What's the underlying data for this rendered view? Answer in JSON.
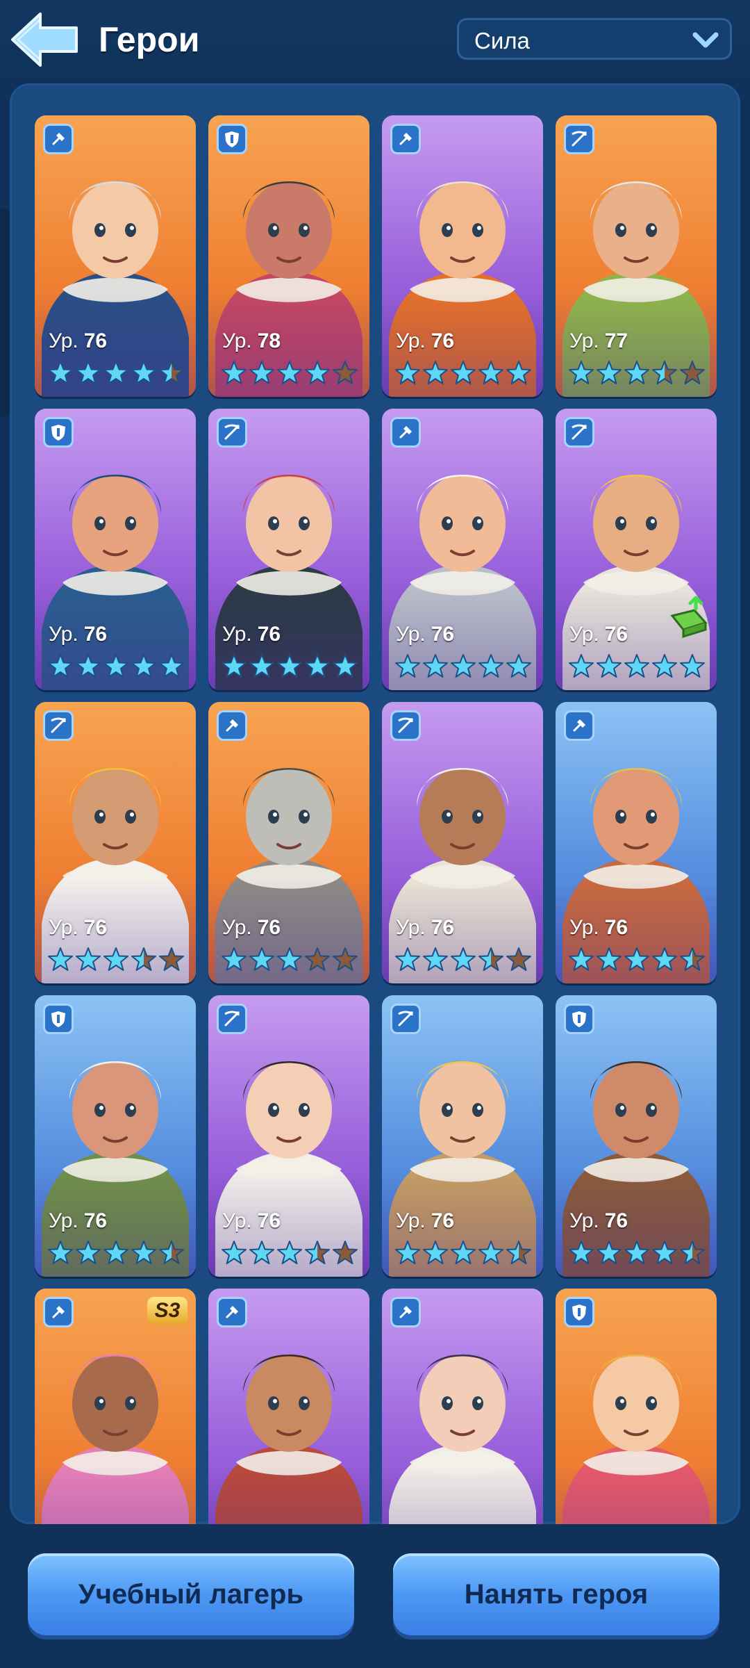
{
  "header": {
    "title": "Герои",
    "sort": {
      "selected": "Сила"
    }
  },
  "level_prefix": "Ур.",
  "heroes": [
    {
      "level": "76",
      "stars": 4.5,
      "class": "shovel",
      "bg": "orange",
      "hair": "#d7dbe6",
      "skin": "#f3c9a8",
      "coat": "#2a4f86"
    },
    {
      "level": "78",
      "stars": 4,
      "class": "shield",
      "bg": "orange",
      "hair": "#3b3b3b",
      "skin": "#c97a68",
      "coat": "#c44764"
    },
    {
      "level": "76",
      "stars": 5,
      "class": "shovel",
      "bg": "purple",
      "hair": "#f0e0c8",
      "skin": "#f1b98d",
      "coat": "#e5702a"
    },
    {
      "level": "77",
      "stars": 3.5,
      "class": "crossbow",
      "bg": "orange",
      "hair": "#e6e6e6",
      "skin": "#e9b089",
      "coat": "#8fb54a"
    },
    {
      "level": "76",
      "stars": 5,
      "class": "shield",
      "bg": "purple",
      "hair": "#1f4a78",
      "skin": "#e7a37e",
      "coat": "#2a5d8f"
    },
    {
      "level": "76",
      "stars": 5,
      "class": "crossbow",
      "bg": "purple",
      "hair": "#d23b3f",
      "skin": "#f2c3a4",
      "coat": "#2b3b47"
    },
    {
      "level": "76",
      "stars": 5,
      "class": "shovel",
      "bg": "purple",
      "hair": "#f6f2ec",
      "skin": "#f1bb98",
      "coat": "#b9bec8"
    },
    {
      "level": "76",
      "stars": 5,
      "class": "crossbow",
      "bg": "purple",
      "hair": "#f1c542",
      "skin": "#e7ad83",
      "coat": "#e8e4dc",
      "upgrade": true
    },
    {
      "level": "76",
      "stars": 3.5,
      "class": "crossbow",
      "bg": "orange",
      "hair": "#f0c33a",
      "skin": "#d59b73",
      "coat": "#f2f0ec"
    },
    {
      "level": "76",
      "stars": 3,
      "class": "shovel",
      "bg": "orange",
      "hair": "#4a4a4a",
      "skin": "#bfbdb7",
      "coat": "#8d8a86"
    },
    {
      "level": "76",
      "stars": 3.5,
      "class": "crossbow",
      "bg": "purple",
      "hair": "#f2efe8",
      "skin": "#b67b57",
      "coat": "#e9e2d4"
    },
    {
      "level": "76",
      "stars": 4.5,
      "class": "shovel",
      "bg": "blue",
      "hair": "#e3c04f",
      "skin": "#e29a76",
      "coat": "#c86a3f"
    },
    {
      "level": "76",
      "stars": 4.5,
      "class": "shield",
      "bg": "blue",
      "hair": "#f3efe6",
      "skin": "#d9967a",
      "coat": "#6f8f48"
    },
    {
      "level": "76",
      "stars": 3.5,
      "class": "crossbow",
      "bg": "purple",
      "hair": "#2b2b2b",
      "skin": "#f5cfb5",
      "coat": "#f0eeea"
    },
    {
      "level": "76",
      "stars": 4.5,
      "class": "crossbow",
      "bg": "blue",
      "hair": "#f3c64a",
      "skin": "#f0c2a2",
      "coat": "#c59c63"
    },
    {
      "level": "76",
      "stars": 4.5,
      "class": "shield",
      "bg": "blue",
      "hair": "#3a2d22",
      "skin": "#cf8a6a",
      "coat": "#8a5b3b"
    },
    {
      "level": "",
      "stars": 0,
      "class": "shovel",
      "bg": "orange",
      "hair": "#e77fb4",
      "skin": "#a86a4d",
      "coat": "#e67fb8",
      "season": "S3"
    },
    {
      "level": "",
      "stars": 0,
      "class": "shovel",
      "bg": "purple",
      "hair": "#3a2a23",
      "skin": "#c98961",
      "coat": "#b9493c"
    },
    {
      "level": "",
      "stars": 0,
      "class": "shovel",
      "bg": "purple",
      "hair": "#3a2f4d",
      "skin": "#f3cdb8",
      "coat": "#f1ede6"
    },
    {
      "level": "",
      "stars": 0,
      "class": "shield",
      "bg": "orange",
      "hair": "#e8b64a",
      "skin": "#f5c9a3",
      "coat": "#e75a6a"
    }
  ],
  "buttons": {
    "training_camp": "Учебный лагерь",
    "hire_hero": "Нанять героя"
  },
  "colors": {
    "star_active": "#5fd8f5",
    "star_inactive": "#8a5a3a",
    "badge_bg": "#2b73c9"
  }
}
